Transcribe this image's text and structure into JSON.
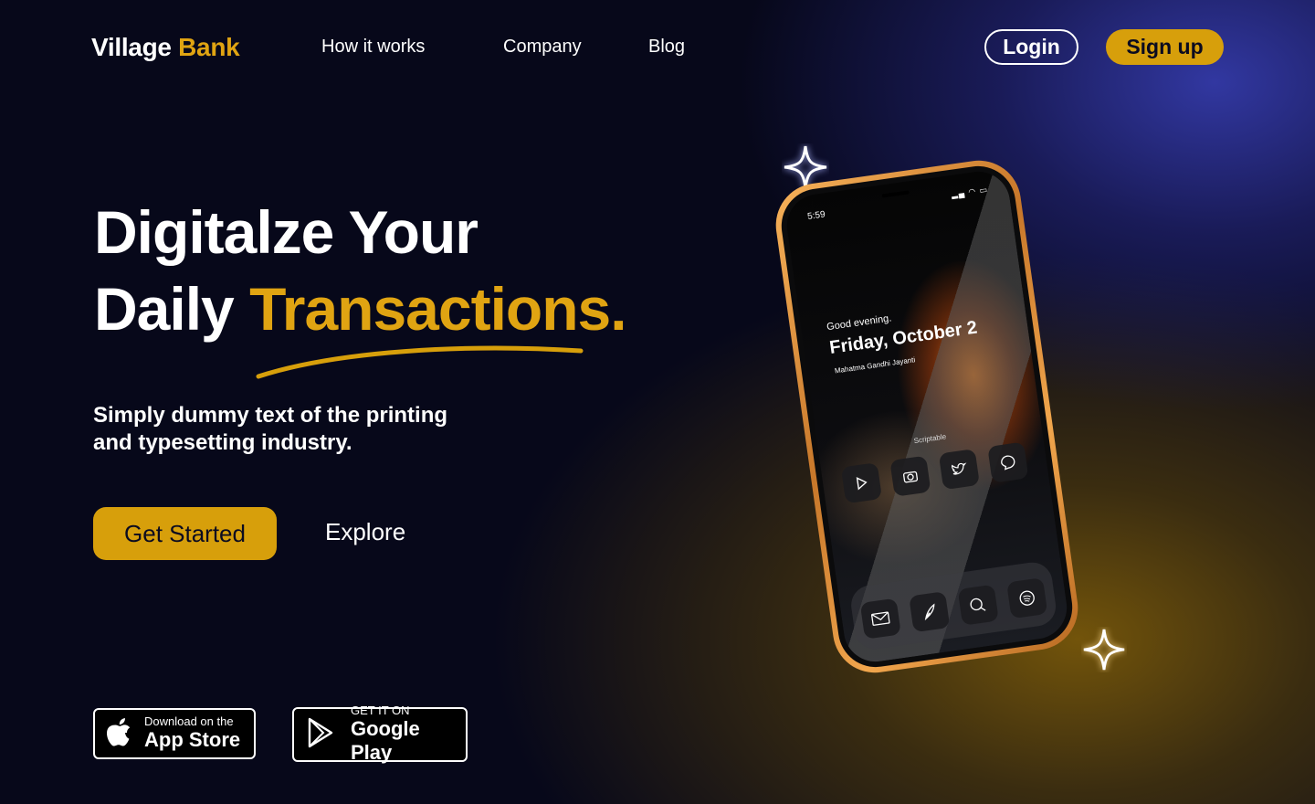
{
  "nav": {
    "logo_primary": "Village",
    "logo_accent": "Bank",
    "links": [
      "How it works",
      "Company",
      "Blog"
    ],
    "login": "Login",
    "signup": "Sign up"
  },
  "hero": {
    "line1": "Digitalze Your",
    "line2_white": "Daily",
    "line2_accent": "Transactions.",
    "subtext": "Simply dummy text of the printing and typesetting industry.",
    "cta_primary": "Get Started",
    "cta_secondary": "Explore"
  },
  "badges": {
    "apple_small": "Download on the",
    "apple_big": "App Store",
    "google_small": "GET IT ON",
    "google_big": "Google Play"
  },
  "phone": {
    "time": "5:59",
    "greeting": "Good evening.",
    "date": "Friday, October 2",
    "holiday": "Mahatma Gandhi Jayanti",
    "widget_label": "Scriptable",
    "top_apps": [
      "play-icon",
      "camera-icon",
      "twitter-icon",
      "chat-icon"
    ],
    "dock_apps": [
      "mail-icon",
      "feather-icon",
      "messages-icon",
      "spotify-icon"
    ]
  },
  "colors": {
    "accent": "#d79f0b",
    "background": "#07081a"
  }
}
